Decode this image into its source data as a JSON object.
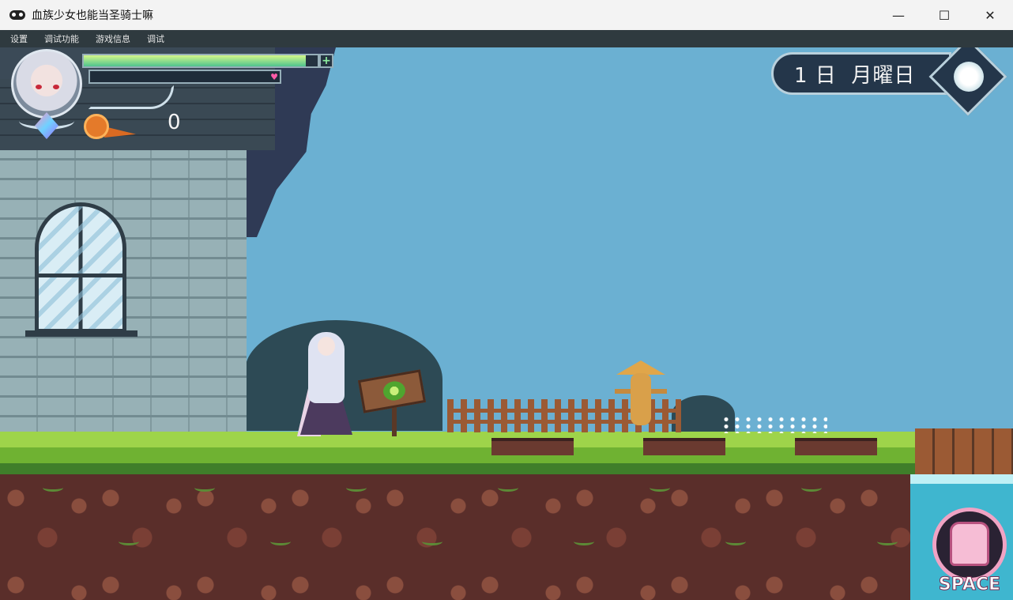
{
  "window": {
    "title": "血族少女也能当圣骑士嘛",
    "minimize": "—",
    "maximize": "☐",
    "close": "✕"
  },
  "menu": [
    "设置",
    "调试功能",
    "游戏信息",
    "调试"
  ],
  "hud": {
    "hp_fraction": 0.95,
    "mp_fraction": 0.0,
    "hp_plus": "+",
    "heart": "♥",
    "gold": "0",
    "date": "1 日  月曜日"
  },
  "space_button": {
    "label": "SPACE"
  },
  "colors": {
    "sky": "#6bb0d2",
    "hp": "#4fc38e",
    "mp": "#b3396a",
    "ui_frame": "#b9d0dc"
  }
}
